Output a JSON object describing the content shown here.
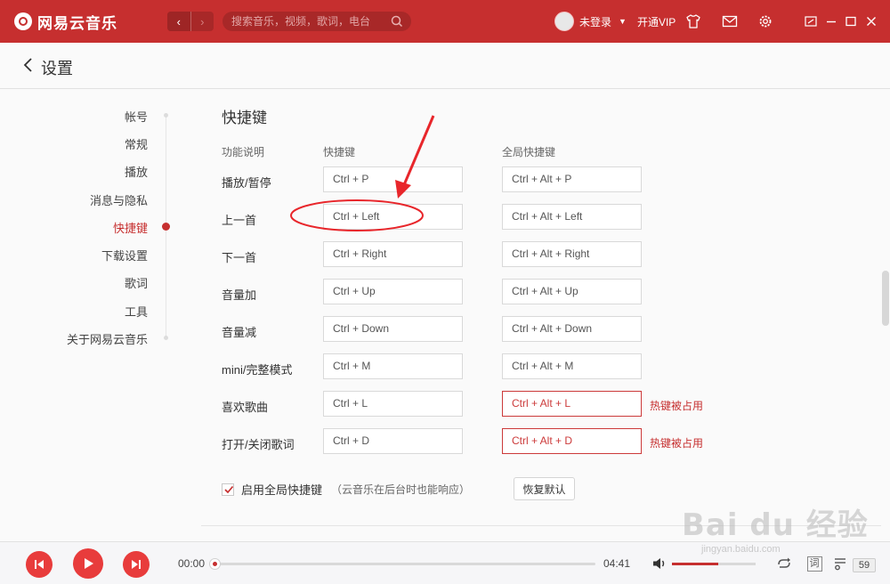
{
  "app": {
    "name": "网易云音乐",
    "nav_back": "‹",
    "nav_forward": "›"
  },
  "search": {
    "placeholder": "搜索音乐，视频，歌词，电台"
  },
  "user": {
    "name": "未登录",
    "vip_link": "开通VIP"
  },
  "page": {
    "title": "设置"
  },
  "sidebar": {
    "items": [
      {
        "label": "帐号",
        "active": false
      },
      {
        "label": "常规",
        "active": false
      },
      {
        "label": "播放",
        "active": false
      },
      {
        "label": "消息与隐私",
        "active": false
      },
      {
        "label": "快捷键",
        "active": true
      },
      {
        "label": "下载设置",
        "active": false
      },
      {
        "label": "歌词",
        "active": false
      },
      {
        "label": "工具",
        "active": false
      },
      {
        "label": "关于网易云音乐",
        "active": false
      }
    ]
  },
  "shortcuts": {
    "section_title": "快捷键",
    "columns": {
      "description": "功能说明",
      "shortcut": "快捷键",
      "global": "全局快捷键"
    },
    "rows": [
      {
        "label": "播放/暂停",
        "local": "Ctrl + P",
        "global": "Ctrl + Alt + P",
        "conflict": false,
        "note": ""
      },
      {
        "label": "上一首",
        "local": "Ctrl + Left",
        "global": "Ctrl + Alt + Left",
        "conflict": false,
        "note": ""
      },
      {
        "label": "下一首",
        "local": "Ctrl + Right",
        "global": "Ctrl + Alt + Right",
        "conflict": false,
        "note": ""
      },
      {
        "label": "音量加",
        "local": "Ctrl + Up",
        "global": "Ctrl + Alt + Up",
        "conflict": false,
        "note": ""
      },
      {
        "label": "音量减",
        "local": "Ctrl + Down",
        "global": "Ctrl + Alt + Down",
        "conflict": false,
        "note": ""
      },
      {
        "label": "mini/完整模式",
        "local": "Ctrl + M",
        "global": "Ctrl + Alt + M",
        "conflict": false,
        "note": ""
      },
      {
        "label": "喜欢歌曲",
        "local": "Ctrl + L",
        "global": "Ctrl + Alt + L",
        "conflict": true,
        "note": "热键被占用"
      },
      {
        "label": "打开/关闭歌词",
        "local": "Ctrl + D",
        "global": "Ctrl + Alt + D",
        "conflict": true,
        "note": "热键被占用"
      }
    ],
    "enable_global_label": "启用全局快捷键",
    "enable_global_hint": "（云音乐在后台时也能响应）",
    "enable_global_checked": true,
    "restore_default_label": "恢复默认"
  },
  "player": {
    "current_time": "00:00",
    "total_time": "04:41",
    "progress": 0,
    "volume": 0.55,
    "lyric_button": "词",
    "playlist_count": "59"
  },
  "watermark": {
    "brand": "Bai du 经验",
    "url": "jingyan.baidu.com"
  },
  "colors": {
    "brand_red": "#c62f2f",
    "conflict_red": "#cc3a3a",
    "annotation_red": "#e8262b"
  },
  "icons": {
    "logo": "netease-music-logo",
    "search": "search-icon",
    "skin": "tshirt-icon",
    "mail": "mail-icon",
    "settings": "gear-icon",
    "mini_mode": "mini-mode-icon",
    "minimize": "minimize-icon",
    "maximize": "maximize-icon",
    "close": "close-icon"
  }
}
